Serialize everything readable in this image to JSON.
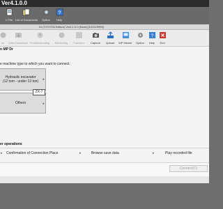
{
  "app": {
    "title": "Ver4.1.0.0",
    "toolbar": [
      {
        "label": "U File",
        "icon": "file-icon"
      },
      {
        "label": "List of Documents",
        "icon": "documents-icon"
      },
      {
        "label": "Option",
        "icon": "option-icon"
      },
      {
        "label": "Help",
        "icon": "help-icon"
      }
    ]
  },
  "window": {
    "title": "Dr (TOYOTA Edition) Ver4.1.0.0 [None] [12/31/9999]",
    "toolbar": [
      {
        "label": "nu",
        "icon": "menu-icon",
        "enabled": false
      },
      {
        "label": "Data Download",
        "icon": "download-icon",
        "enabled": false
      },
      {
        "label": "Troubleshooting",
        "icon": "troubleshooting-icon",
        "enabled": false
      },
      {
        "label": "Monitoring",
        "icon": "monitoring-icon",
        "enabled": false
      },
      {
        "label": "Function",
        "icon": "function-icon",
        "enabled": false
      },
      {
        "label": "Capture",
        "icon": "capture-icon",
        "enabled": true
      },
      {
        "label": "Upload",
        "icon": "upload-icon",
        "enabled": true
      },
      {
        "label": "MP Viewer",
        "icon": "viewer-icon",
        "enabled": true
      },
      {
        "label": "Option",
        "icon": "option-icon",
        "enabled": true
      },
      {
        "label": "Help",
        "icon": "help-icon",
        "enabled": true
      },
      {
        "label": "End",
        "icon": "end-icon",
        "enabled": true
      }
    ]
  },
  "main": {
    "section_title": "n MP Dr",
    "section_desc": "e machine type to which you want to connect.",
    "models": [
      {
        "line1": "Hydraulic excavator",
        "line2": "(12 tom - under 13 ton)"
      },
      {
        "line1": "Others",
        "line2": ""
      }
    ],
    "sub_option": "ZX-7"
  },
  "other_ops": {
    "title": "er operations",
    "items": [
      "Confirmation of Connection Place",
      "Browse save data",
      "Play recorded file"
    ]
  },
  "connect_label": "Connect(C)",
  "colors": {
    "title_bar": "#2b2b2b",
    "app_toolbar": "#6a6a6a",
    "content_bg": "#f4f4f4"
  }
}
